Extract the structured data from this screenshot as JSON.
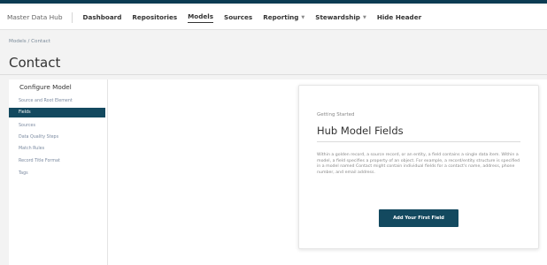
{
  "app": {
    "brand": "Master Data Hub"
  },
  "nav": {
    "items": [
      {
        "label": "Dashboard"
      },
      {
        "label": "Repositories"
      },
      {
        "label": "Models"
      },
      {
        "label": "Sources"
      },
      {
        "label": "Reporting"
      },
      {
        "label": "Stewardship"
      },
      {
        "label": "Hide Header"
      }
    ],
    "active": "Models"
  },
  "breadcrumb": "Models / Contact",
  "page_title": "Contact",
  "sidebar": {
    "heading": "Configure Model",
    "items": [
      {
        "label": "Source and Root Element"
      },
      {
        "label": "Fields",
        "selected": true
      },
      {
        "label": "Sources"
      },
      {
        "label": "Data Quality Steps"
      },
      {
        "label": "Match Rules"
      },
      {
        "label": "Record Title Format"
      },
      {
        "label": "Tags"
      }
    ]
  },
  "card": {
    "eyebrow": "Getting Started",
    "title": "Hub Model Fields",
    "body": "Within a golden record, a source record, or an entity, a field contains a single data item. Within a model, a field specifies a property of an object. For example, a record/entity structure is specified in a model named Contact might contain individual fields for a contact's name, address, phone number, and email address.",
    "button_label": "Add Your First Field"
  },
  "colors": {
    "accent": "#13495f",
    "topbar": "#0c3b52"
  }
}
